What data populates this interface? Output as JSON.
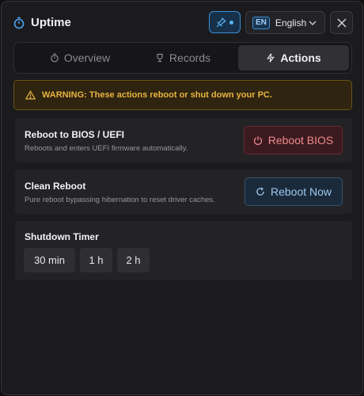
{
  "app": {
    "title": "Uptime",
    "icon": "stopwatch-icon"
  },
  "titlebar": {
    "pin_icon": "pin-icon",
    "language": {
      "code": "EN",
      "name": "English"
    },
    "close_icon": "close-icon"
  },
  "tabs": [
    {
      "label": "Overview",
      "icon": "stopwatch-icon",
      "active": false
    },
    {
      "label": "Records",
      "icon": "trophy-icon",
      "active": false
    },
    {
      "label": "Actions",
      "icon": "lightning-icon",
      "active": true
    }
  ],
  "warning": {
    "text": "WARNING: These actions reboot or shut down your PC.",
    "icon": "warning-icon"
  },
  "cards": {
    "bios": {
      "title": "Reboot to BIOS / UEFI",
      "description": "Reboots and enters UEFI firmware automatically.",
      "button_label": "Reboot BIOS",
      "button_icon": "power-icon"
    },
    "clean": {
      "title": "Clean Reboot",
      "description": "Pure reboot bypassing hibernation to reset driver caches.",
      "button_label": "Reboot Now",
      "button_icon": "refresh-icon"
    },
    "timer": {
      "title": "Shutdown Timer",
      "options": [
        "30 min",
        "1 h",
        "2 h"
      ]
    }
  },
  "colors": {
    "accent": "#3b8fd6",
    "warning": "#e9b340",
    "danger": "#f08a8e"
  }
}
